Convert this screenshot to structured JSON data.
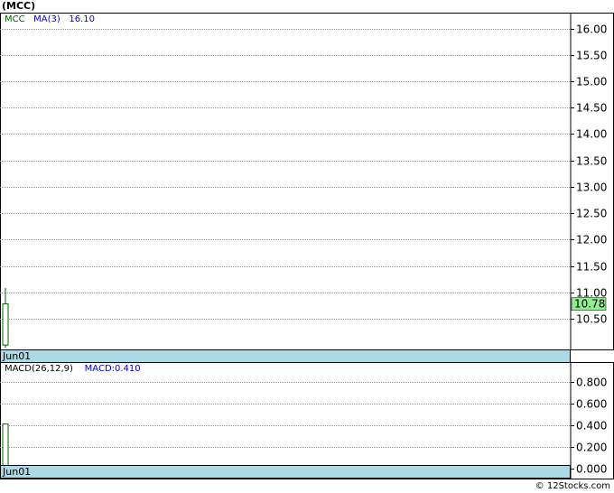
{
  "header": {
    "title": "(MCC)"
  },
  "price_panel": {
    "legend": {
      "symbol": "MCC",
      "ma_label": "MA(3)",
      "ma_value": "16.10"
    },
    "ticks": [
      "16.00",
      "15.50",
      "15.00",
      "14.50",
      "14.00",
      "13.50",
      "13.00",
      "12.50",
      "12.00",
      "11.50",
      "11.00",
      "10.50"
    ],
    "last_price": "10.78",
    "last_price_color": "#90ee90",
    "date_label": "Jun01"
  },
  "macd_panel": {
    "legend": {
      "label": "MACD(26,12,9)",
      "value_label": "MACD:0.410"
    },
    "ticks": [
      "0.800",
      "0.600",
      "0.400",
      "0.200",
      "0.000"
    ],
    "date_label": "Jun01"
  },
  "footer": {
    "credit": "© 12Stocks.com"
  },
  "colors": {
    "up_candle": "#006400",
    "grid": "#999999",
    "date_bar": "#add8e6"
  },
  "chart_data": [
    {
      "type": "candlestick",
      "title": "(MCC)",
      "x": [
        "Jun01"
      ],
      "series": [
        {
          "name": "MCC",
          "open": [
            10.0
          ],
          "high": [
            11.08
          ],
          "low": [
            9.95
          ],
          "close": [
            10.78
          ]
        }
      ],
      "moving_average": {
        "name": "MA(3)",
        "value": 16.1
      },
      "ylim": [
        9.9,
        16.3
      ],
      "ytick_values": [
        16.0,
        15.5,
        15.0,
        14.5,
        14.0,
        13.5,
        13.0,
        12.5,
        12.0,
        11.5,
        11.0,
        10.5
      ],
      "grid": true
    },
    {
      "type": "bar",
      "title": "MACD(26,12,9)",
      "x": [
        "Jun01"
      ],
      "series": [
        {
          "name": "MACD",
          "values": [
            0.41
          ]
        }
      ],
      "ylim": [
        -0.1,
        0.98
      ],
      "ytick_values": [
        0.8,
        0.6,
        0.4,
        0.2,
        0.0
      ],
      "grid": true
    }
  ]
}
